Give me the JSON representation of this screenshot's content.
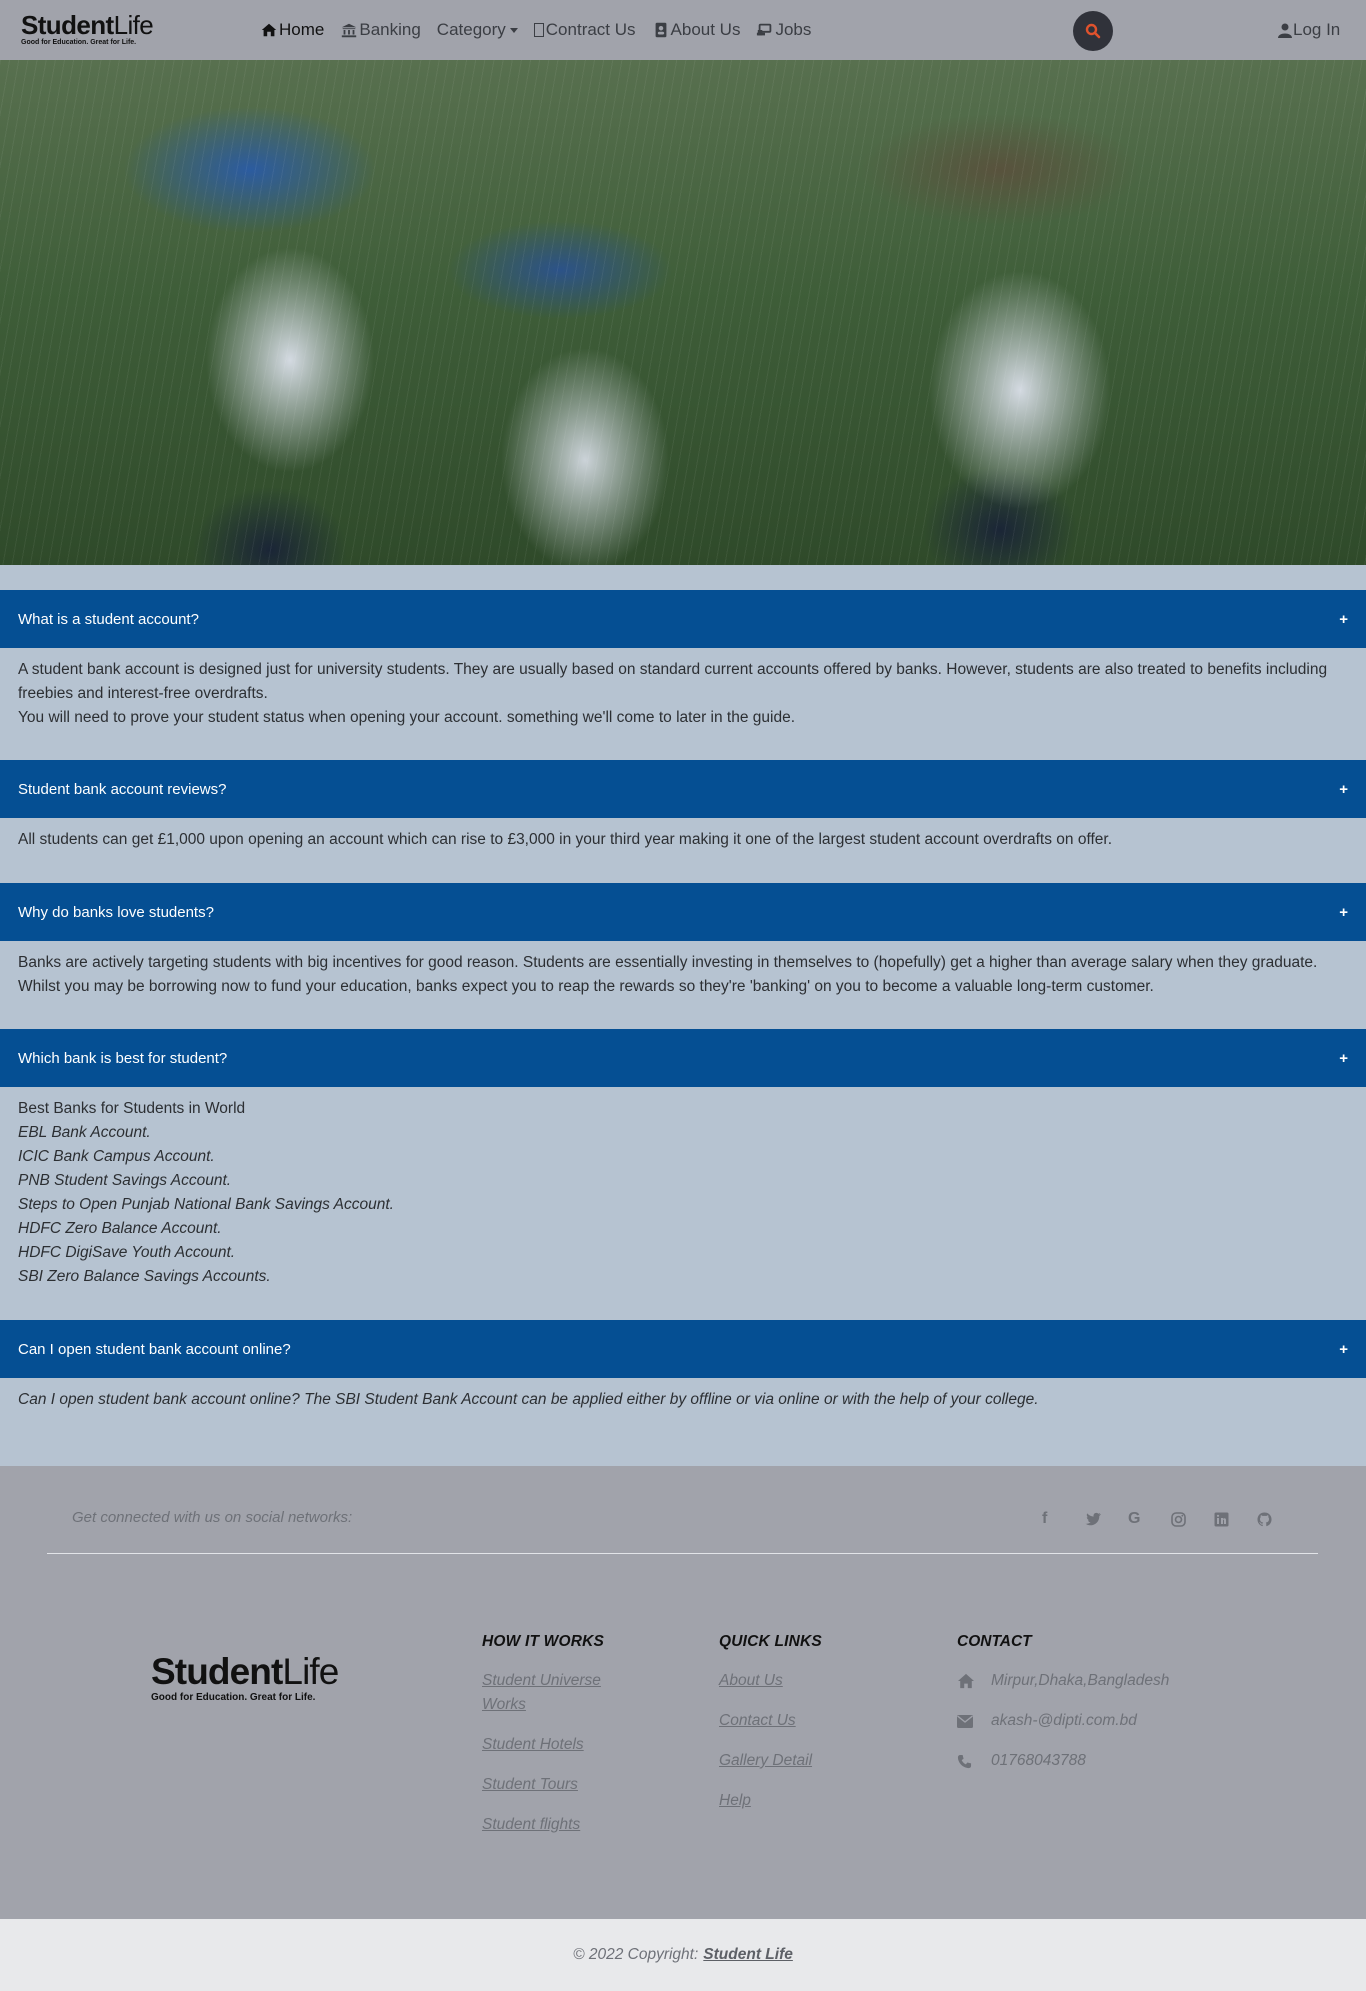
{
  "brand": {
    "bold": "Student",
    "light": "Life",
    "tagline": "Good for Education. Great for Life."
  },
  "nav": {
    "items": [
      {
        "label": "Home",
        "icon": "home-icon"
      },
      {
        "label": "Banking",
        "icon": "bank-icon"
      },
      {
        "label": "Category",
        "icon": "chevron-down-icon"
      },
      {
        "label": "Contract Us",
        "icon": "contact-icon"
      },
      {
        "label": "About Us",
        "icon": "id-card-icon"
      },
      {
        "label": "Jobs",
        "icon": "laptop-icon"
      }
    ],
    "login": "Log In"
  },
  "hero": {
    "alt": "Children in school uniforms laughing in the rain holding bags over their heads"
  },
  "faq": [
    {
      "question": "What is a student account?",
      "lines": [
        "A student bank account is designed just for university students. They are usually based on standard current accounts offered by banks. However, students are also treated to benefits including freebies and interest-free overdrafts.",
        "You will need to prove your student status when opening your account. something we'll come to later in the guide."
      ]
    },
    {
      "question": "Student bank account reviews?",
      "lines": [
        "All students can get £1,000 upon opening an account which can rise to £3,000 in your third year making it one of the largest student account overdrafts on offer."
      ]
    },
    {
      "question": "Why do banks love students?",
      "lines": [
        "Banks are actively targeting students with big incentives for good reason. Students are essentially investing in themselves to (hopefully) get a higher than average salary when they graduate. Whilst you may be borrowing now to fund your education, banks expect you to reap the rewards so they're 'banking' on you to become a valuable long-term customer."
      ]
    },
    {
      "question": "Which bank is best for student?",
      "intro": "Best Banks for Students in World",
      "banks": [
        "EBL Bank Account.",
        "ICIC Bank Campus Account.",
        "PNB Student Savings Account.",
        "Steps to Open Punjab National Bank Savings Account.",
        "HDFC Zero Balance Account.",
        "HDFC DigiSave Youth Account.",
        "SBI Zero Balance Savings Accounts."
      ]
    },
    {
      "question": "Can I open student bank account online?",
      "italic": "Can I open student bank account online? The SBI Student Bank Account can be applied either by offline or via online or with the help of your college."
    }
  ],
  "footer": {
    "social_text": "Get connected with us on social networks:",
    "social_icons": [
      "facebook-icon",
      "twitter-icon",
      "google-icon",
      "instagram-icon",
      "linkedin-icon",
      "github-icon"
    ],
    "how_it_works": {
      "title": "HOW IT WORKS",
      "links": [
        "Student Universe Works",
        "Student Hotels",
        "Student Tours",
        "Student flights"
      ]
    },
    "quick_links": {
      "title": "QUICK LINKS",
      "links": [
        "About Us",
        "Contact Us",
        "Gallery Detail",
        "Help"
      ]
    },
    "contact": {
      "title": "CONTACT",
      "address": "Mirpur,Dhaka,Bangladesh",
      "email": "akash-@dipti.com.bd",
      "phone": "01768043788"
    },
    "copyright_text": "© 2022 Copyright:",
    "copyright_link": "Student Life"
  }
}
